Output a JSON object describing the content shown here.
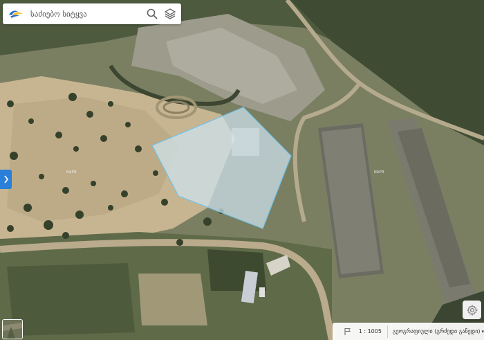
{
  "search": {
    "placeholder": "საძიებო სიტყვა"
  },
  "icons": {
    "search": "search-icon",
    "layers": "layers-icon",
    "expand": "chevron-right-icon",
    "settings": "gear-icon",
    "scale_marker": "flag-icon",
    "basemap": "basemap-thumbnail"
  },
  "map": {
    "labels": [
      "NAPR",
      "NAPR"
    ],
    "parcel_color": "#cfe3ee",
    "parcel_outline": "#6ec3e8"
  },
  "status_bar": {
    "scale": "1 : 1005",
    "coordinate_system": "გეოგრაფიული (გრძედი განედი)"
  },
  "colors": {
    "accent": "#2a7fd8",
    "logo_blue": "#2a6fd0",
    "logo_yellow": "#f2c230"
  }
}
